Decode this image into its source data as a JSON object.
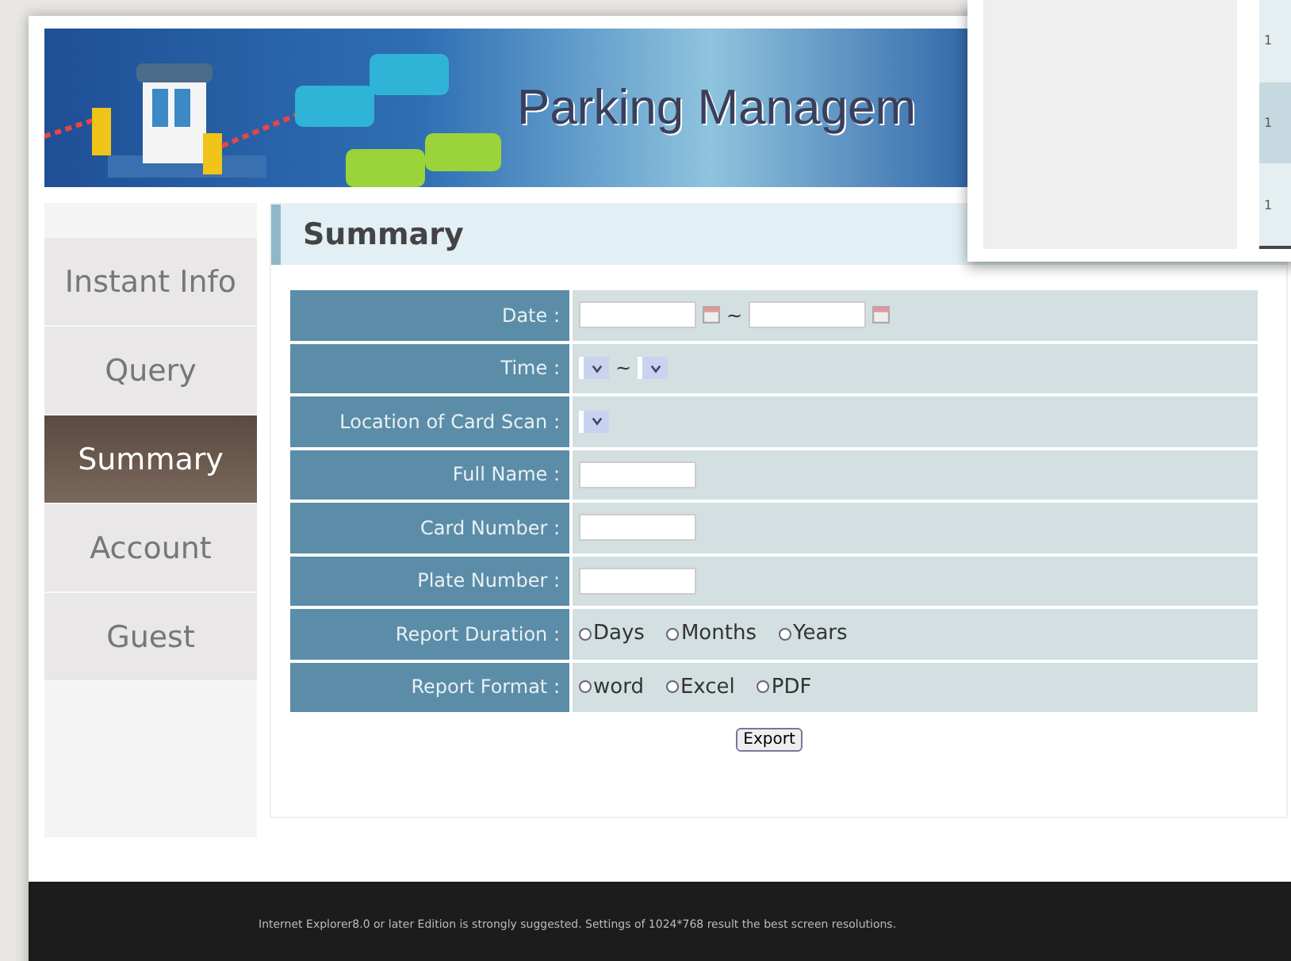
{
  "banner": {
    "title": "Parking Managem"
  },
  "sidebar": {
    "items": [
      {
        "label": "Instant Info",
        "selected": false
      },
      {
        "label": "Query",
        "selected": false
      },
      {
        "label": "Summary",
        "selected": true
      },
      {
        "label": "Account",
        "selected": false
      },
      {
        "label": "Guest",
        "selected": false
      }
    ]
  },
  "panel": {
    "title": "Summary"
  },
  "form": {
    "rows": [
      {
        "label": "Date :",
        "kind": "date_range",
        "separator": "~"
      },
      {
        "label": "Time :",
        "kind": "time_range",
        "separator": "~"
      },
      {
        "label": "Location of Card Scan :",
        "kind": "select"
      },
      {
        "label": "Full Name :",
        "kind": "text"
      },
      {
        "label": "Card Number :",
        "kind": "text"
      },
      {
        "label": "Plate Number :",
        "kind": "text"
      },
      {
        "label": "Report Duration :",
        "kind": "radio",
        "options": [
          {
            "label": "Days",
            "selected": false
          },
          {
            "label": "Months",
            "selected": false
          },
          {
            "label": "Years",
            "selected": false
          }
        ]
      },
      {
        "label": "Report Format :",
        "kind": "radio",
        "options": [
          {
            "label": "word",
            "selected": false
          },
          {
            "label": "Excel",
            "selected": false
          },
          {
            "label": "PDF",
            "selected": false
          }
        ]
      }
    ],
    "button": "Export"
  },
  "overlay_window": {
    "cells": [
      "1",
      "1",
      "1"
    ]
  },
  "footer": {
    "text": "Internet Explorer8.0 or later Edition is strongly suggested. Settings of 1024*768 result the best screen resolutions."
  }
}
